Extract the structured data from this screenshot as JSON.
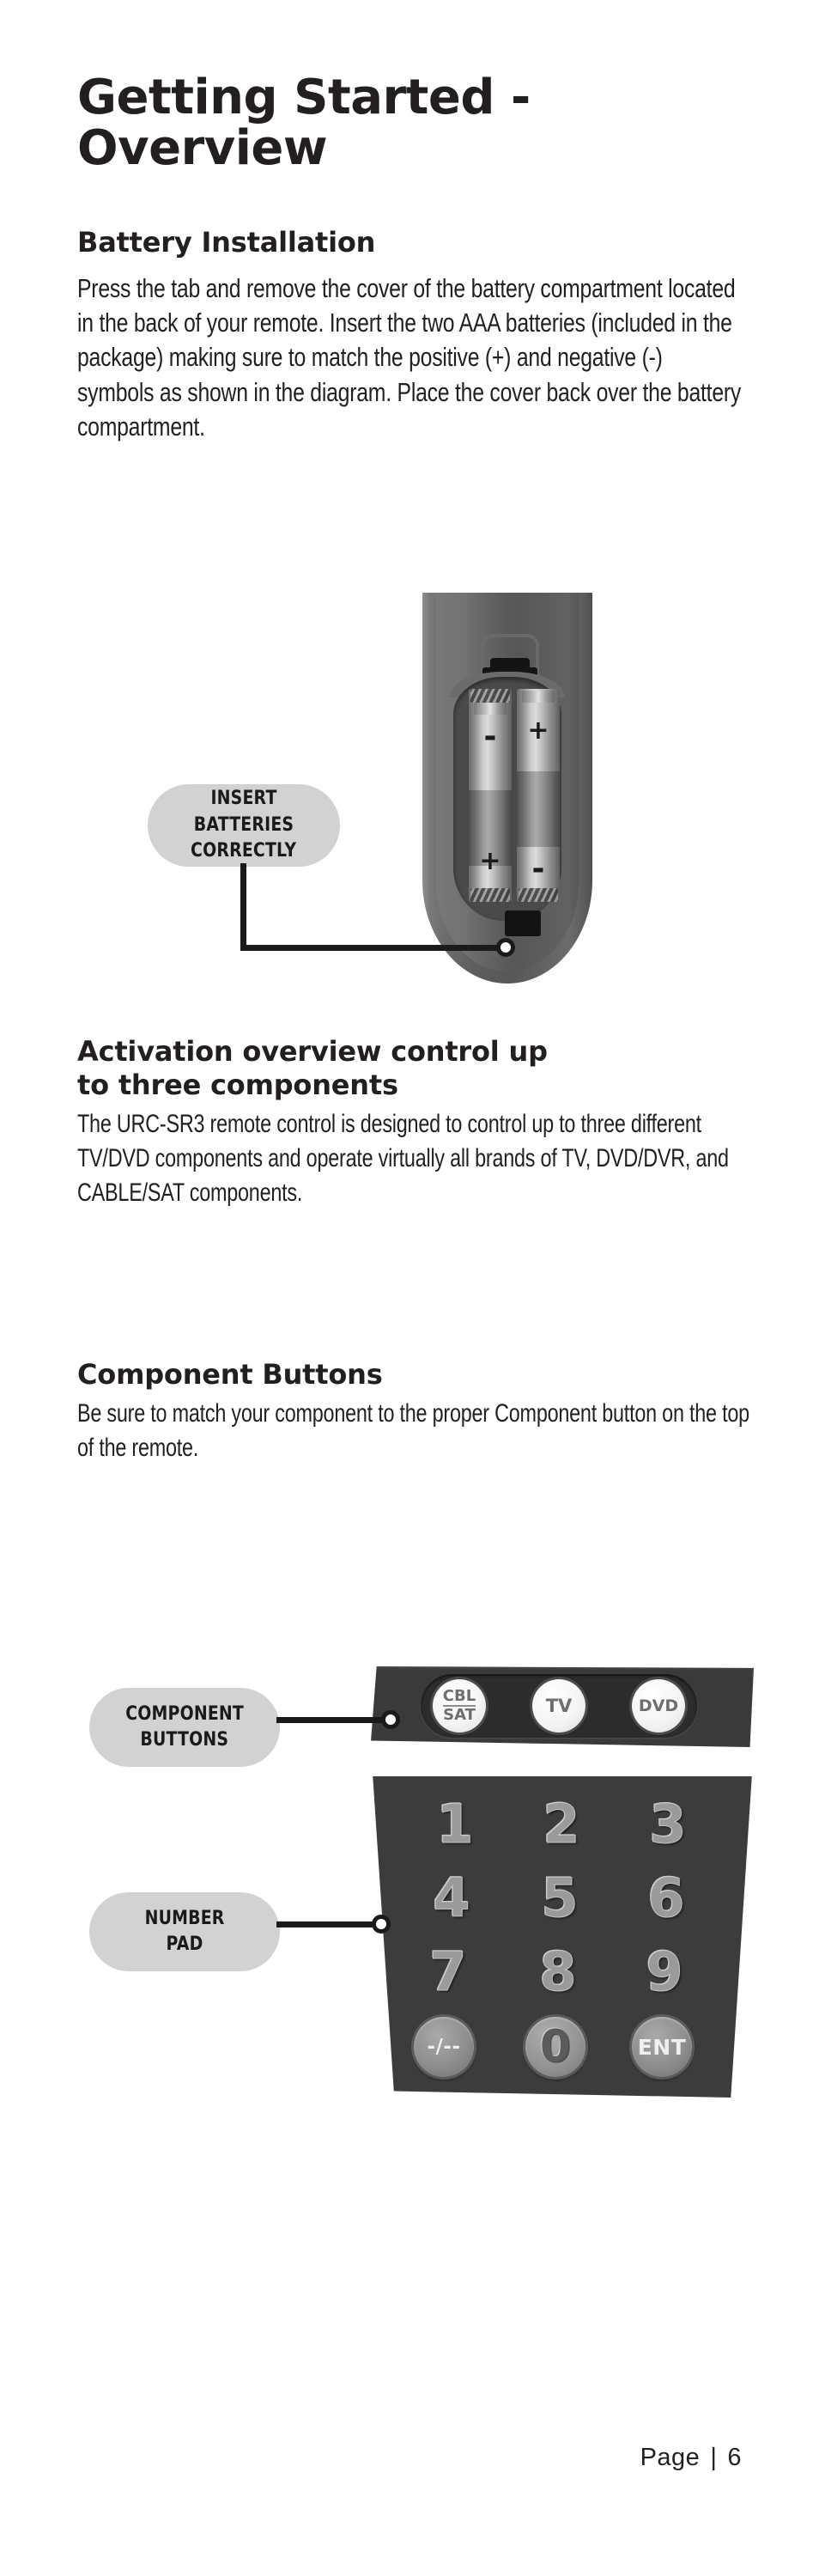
{
  "page_title": "Getting Started - Overview",
  "sections": {
    "battery": {
      "heading": "Battery Installation",
      "body": "Press the tab and remove the cover of the battery compartment located in the back of your remote. Insert the two AAA batteries (included in the package) making sure to match the positive (+) and negative (-) symbols as shown in the diagram. Place the cover back over the battery compartment."
    },
    "activation": {
      "heading_line1": "Activation overview control up",
      "heading_line2": "to three components",
      "body": "The URC-SR3 remote control is designed to control up to three different TV/DVD components and operate virtually all brands of TV, DVD/DVR, and CABLE/SAT components."
    },
    "component": {
      "heading": "Component Buttons",
      "body": "Be sure to match your component to the proper Component button on the top of the remote."
    }
  },
  "callouts": {
    "batteries": {
      "line1": "INSERT BATTERIES",
      "line2": "CORRECTLY"
    },
    "component_buttons": {
      "line1": "COMPONENT",
      "line2": "BUTTONS"
    },
    "number_pad": {
      "line1": "NUMBER",
      "line2": "PAD"
    }
  },
  "battery_diagram": {
    "left_battery": {
      "top_polarity": "-",
      "bottom_polarity": "+"
    },
    "right_battery": {
      "top_polarity": "+",
      "bottom_polarity": "-"
    }
  },
  "remote_diagram": {
    "component_buttons": [
      {
        "name": "cbl-sat",
        "line1": "CBL",
        "line2": "SAT"
      },
      {
        "name": "tv",
        "label": "TV"
      },
      {
        "name": "dvd",
        "label": "DVD"
      }
    ],
    "number_pad": {
      "digits": [
        "1",
        "2",
        "3",
        "4",
        "5",
        "6",
        "7",
        "8",
        "9"
      ],
      "minus_label": "-/--",
      "zero_label": "0",
      "enter_label": "ENT"
    }
  },
  "footer": {
    "page_word": "Page",
    "separator": "|",
    "page_number": "6"
  }
}
